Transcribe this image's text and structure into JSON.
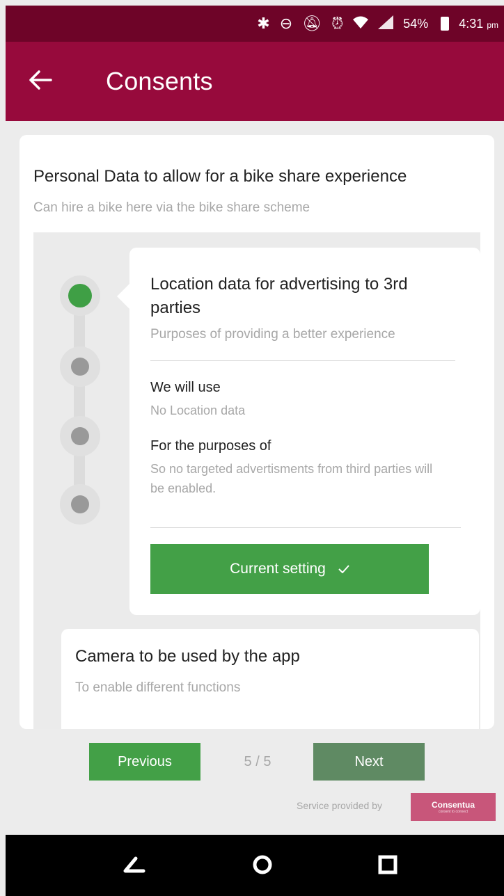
{
  "status_bar": {
    "battery_percent": "54%",
    "time": "4:31",
    "time_suffix": "pm",
    "icons": [
      "bluetooth-icon",
      "do-not-disturb-icon",
      "notifications-off-icon",
      "alarm-icon",
      "wifi-icon",
      "signal-icon",
      "battery-icon"
    ]
  },
  "app_bar": {
    "title": "Consents",
    "back_icon": "arrow-left-icon"
  },
  "consent": {
    "title": "Personal Data to allow for a bike share experience",
    "subtitle": "Can hire a bike here via the bike share scheme"
  },
  "option": {
    "title": "Location data for advertising to 3rd parties",
    "subtitle": "Purposes of providing a better experience",
    "we_will_use_label": "We will use",
    "we_will_use_value": "No Location data",
    "purposes_label": "For the purposes of",
    "purposes_value": "So no targeted advertisments from third parties will be enabled.",
    "button_label": "Current setting"
  },
  "next_consent": {
    "title": "Camera to be used by the app",
    "subtitle": "To enable different functions"
  },
  "pager": {
    "previous_label": "Previous",
    "page_indicator": "5 / 5",
    "next_label": "Next"
  },
  "footer": {
    "provided_text": "Service provided by",
    "logo_text": "Consentua",
    "logo_tagline": "consent to connect"
  },
  "colors": {
    "status_bar": "#6e0428",
    "app_bar": "#970a3c",
    "accent_green": "#43a047",
    "muted_green": "#5f8a63",
    "logo_pink": "#c8567a"
  }
}
